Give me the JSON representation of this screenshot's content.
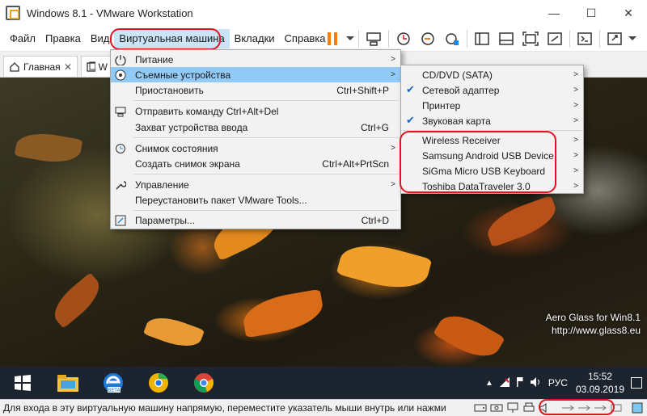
{
  "window": {
    "title": "Windows 8.1 - VMware Workstation",
    "controls": {
      "minimize": "—",
      "maximize": "☐",
      "close": "✕"
    }
  },
  "menubar": {
    "items": [
      "Файл",
      "Правка",
      "Вид",
      "Виртуальная машина",
      "Вкладки",
      "Справка"
    ]
  },
  "tabs": {
    "home": "Главная",
    "vm_partial": "W"
  },
  "vm_menu": {
    "items": [
      {
        "label": "Питание",
        "shortcut": "",
        "icon": "power-icon"
      },
      {
        "label": "Съемные устройства",
        "shortcut": "",
        "icon": "removable-devices-icon"
      },
      {
        "label": "Приостановить",
        "shortcut": "Ctrl+Shift+P",
        "icon": ""
      },
      {
        "label": "Отправить команду Ctrl+Alt+Del",
        "shortcut": "",
        "icon": "send-keys-icon"
      },
      {
        "label": "Захват устройства ввода",
        "shortcut": "Ctrl+G",
        "icon": ""
      },
      {
        "label": "Снимок состояния",
        "shortcut": "",
        "icon": "snapshot-icon"
      },
      {
        "label": "Создать снимок экрана",
        "shortcut": "Ctrl+Alt+PrtScn",
        "icon": ""
      },
      {
        "label": "Управление",
        "shortcut": "",
        "icon": "wrench-icon"
      },
      {
        "label": "Переустановить пакет VMware Tools...",
        "shortcut": "",
        "icon": ""
      },
      {
        "label": "Параметры...",
        "shortcut": "Ctrl+D",
        "icon": "settings-icon"
      }
    ]
  },
  "devices_menu": {
    "items": [
      {
        "label": "CD/DVD (SATA)",
        "checked": false
      },
      {
        "label": "Сетевой адаптер",
        "checked": true
      },
      {
        "label": "Принтер",
        "checked": false
      },
      {
        "label": "Звуковая карта",
        "checked": true
      },
      {
        "label": "Wireless Receiver",
        "checked": false
      },
      {
        "label": "Samsung Android USB Device",
        "checked": false
      },
      {
        "label": "SiGma Micro USB Keyboard",
        "checked": false
      },
      {
        "label": "Toshiba DataTraveler 3.0",
        "checked": false
      }
    ]
  },
  "desktop": {
    "watermark_line1": "Aero Glass for Win8.1",
    "watermark_line2": "http://www.glass8.eu"
  },
  "taskbar": {
    "language": "РУС",
    "time": "15:52",
    "date": "03.09.2019"
  },
  "statusbar": {
    "text": "Для входа в эту виртуальную машину напрямую, переместите указатель мыши внутрь или нажмите"
  },
  "colors": {
    "highlight_red": "#e0141f",
    "menu_highlight": "#91c9f7",
    "pause_orange": "#f07d16"
  }
}
